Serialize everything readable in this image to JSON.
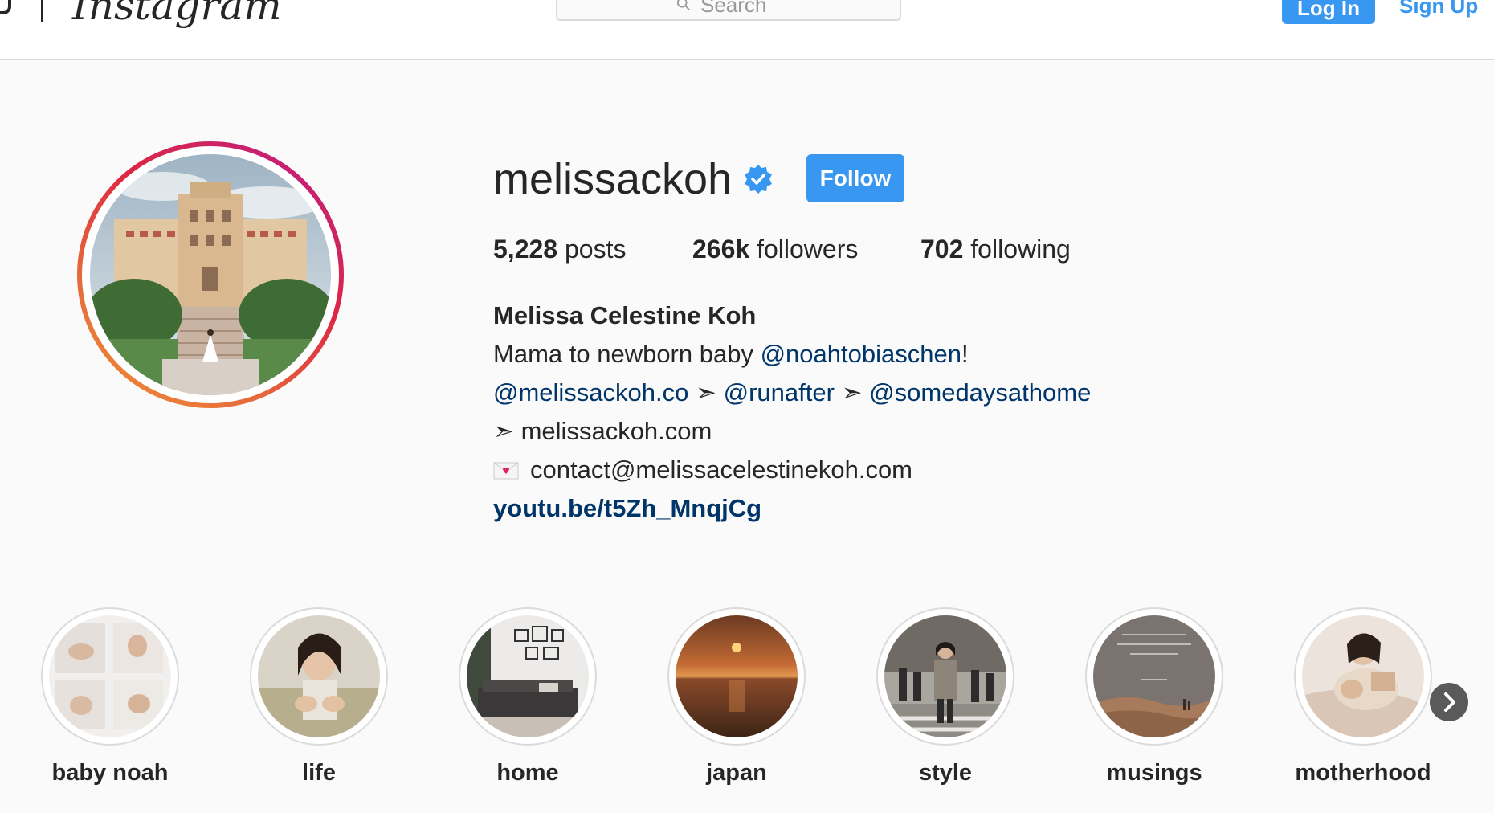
{
  "header": {
    "wordmark": "Instagram",
    "search_placeholder": "Search",
    "login_label": "Log In",
    "signup_label": "Sign Up"
  },
  "profile": {
    "username": "melissackoh",
    "verified": true,
    "follow_label": "Follow",
    "stats": {
      "posts_count": "5,228",
      "posts_label": "posts",
      "followers_count": "266k",
      "followers_label": "followers",
      "following_count": "702",
      "following_label": "following"
    },
    "full_name": "Melissa Celestine Koh",
    "bio": {
      "line1_text": "Mama to newborn baby ",
      "line1_mention": "@noahtobiaschen",
      "line1_suffix": "!",
      "line2_mentions": [
        "@melissackoh.co",
        "@runafter",
        "@somedaysathome"
      ],
      "arrow": "➣",
      "line3_text": "melissackoh.com",
      "line4_email": "contact@melissacelestinekoh.com",
      "link": "youtu.be/t5Zh_MnqjCg"
    }
  },
  "highlights": [
    {
      "label": "baby noah"
    },
    {
      "label": "life"
    },
    {
      "label": "home"
    },
    {
      "label": "japan"
    },
    {
      "label": "style"
    },
    {
      "label": "musings"
    },
    {
      "label": "motherhood"
    }
  ],
  "colors": {
    "accent_blue": "#3897f0",
    "link_navy": "#003569",
    "text_dark": "#262626",
    "background": "#fafafa",
    "border": "#dbdbdb"
  },
  "icons": {
    "verified": "verified-badge-icon",
    "search": "search-icon",
    "next": "chevron-right-icon",
    "envelope": "love-letter-icon",
    "logo": "instagram-camera-icon"
  }
}
